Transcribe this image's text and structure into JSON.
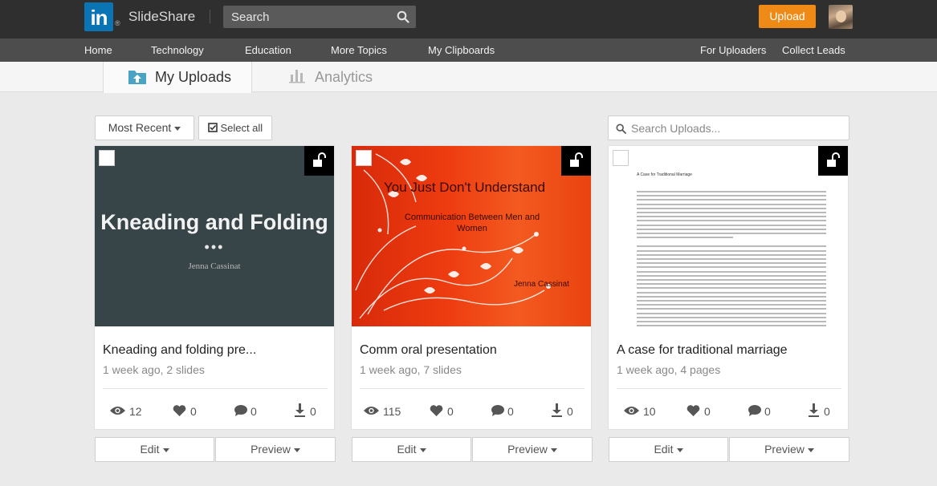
{
  "header": {
    "brand": "SlideShare",
    "registered_mark": "®",
    "logo_text": "in",
    "search_placeholder": "Search",
    "upload_label": "Upload"
  },
  "nav": {
    "left": [
      "Home",
      "Technology",
      "Education",
      "More Topics",
      "My Clipboards"
    ],
    "right": [
      "For Uploaders",
      "Collect Leads"
    ]
  },
  "tabs": [
    {
      "label": "My Uploads",
      "active": true
    },
    {
      "label": "Analytics",
      "active": false
    }
  ],
  "toolbar": {
    "sort_label": "Most Recent",
    "select_all_label": "Select all",
    "search_placeholder": "Search Uploads..."
  },
  "cards": [
    {
      "title": "Kneading and folding pre...",
      "meta": "1 week ago, 2 slides",
      "views": "12",
      "likes": "0",
      "comments": "0",
      "downloads": "0",
      "thumb": {
        "title": "Kneading and Folding",
        "dots": "•••",
        "author": "Jenna Cassinat"
      },
      "edit_label": "Edit",
      "preview_label": "Preview"
    },
    {
      "title": "Comm oral presentation",
      "meta": "1 week ago, 7 slides",
      "views": "115",
      "likes": "0",
      "comments": "0",
      "downloads": "0",
      "thumb": {
        "title": "You Just Don't Understand",
        "subtitle": "Communication Between Men and Women",
        "author": "Jenna Cassinat"
      },
      "edit_label": "Edit",
      "preview_label": "Preview"
    },
    {
      "title": "A case for traditional marriage",
      "meta": "1 week ago, 4 pages",
      "views": "10",
      "likes": "0",
      "comments": "0",
      "downloads": "0",
      "thumb": {
        "title": "A Case for Traditional Marriage"
      },
      "edit_label": "Edit",
      "preview_label": "Preview"
    }
  ],
  "colors": {
    "topbar": "#2f2f2f",
    "navbar": "#4d4d4d",
    "upload_button": "#ef8a16",
    "linkedin_blue": "#0a74b5",
    "active_tab_icon": "#4aa3c4"
  },
  "icons": {
    "search": "search-icon",
    "uploads_tab": "folder-upload-icon",
    "analytics_tab": "bar-chart-icon",
    "checkbox": "checkbox-checked-icon",
    "lock": "unlock-icon",
    "views": "eye-icon",
    "likes": "heart-icon",
    "comments": "comment-icon",
    "downloads": "download-icon"
  }
}
